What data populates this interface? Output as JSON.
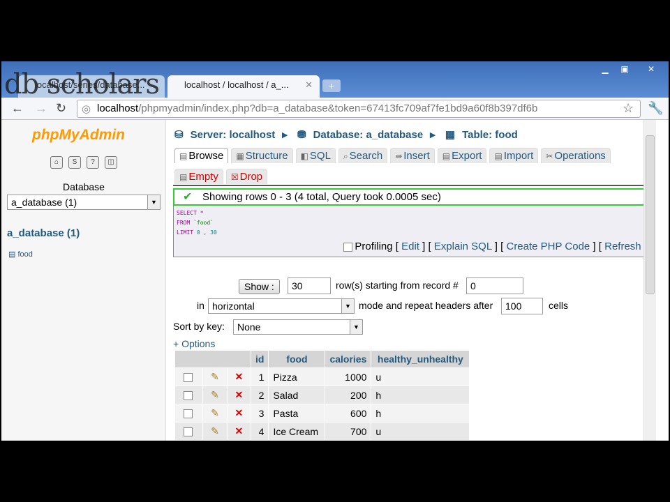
{
  "browser": {
    "tabs": [
      {
        "title": "localhost/series/database..."
      },
      {
        "title": "localhost / localhost / a_..."
      }
    ],
    "url_host": "localhost",
    "url_path": "/phpmyadmin/index.php?db=a_database&token=67413fc709af7fe1bd9a60f8b397df6b",
    "watermark": "db scholars"
  },
  "sidebar": {
    "logo_php": "php",
    "logo_myadmin": "MyAdmin",
    "database_label": "Database",
    "database_selected": "a_database (1)",
    "db_link": "a_database (1)",
    "tables": [
      "food"
    ]
  },
  "breadcrumb": {
    "server": "Server: localhost",
    "database": "Database: a_database",
    "table": "Table: food"
  },
  "tabs": [
    "Browse",
    "Structure",
    "SQL",
    "Search",
    "Insert",
    "Export",
    "Import",
    "Operations"
  ],
  "tabs2": [
    "Empty",
    "Drop"
  ],
  "message": "Showing rows 0 - 3 (4 total, Query took 0.0005 sec)",
  "sql": {
    "line1_kw": "SELECT",
    "line1_rest": " *",
    "line2_kw": "FROM",
    "line2_rest": " `food`",
    "line3_kw": "LIMIT",
    "line3_rest": " 0 , 30"
  },
  "sql_links": {
    "profiling": "Profiling",
    "edit": "Edit",
    "explain": "Explain SQL",
    "php": "Create PHP Code",
    "refresh": "Refresh"
  },
  "nav_form": {
    "show_button": "Show :",
    "rows_value": "30",
    "rows_label": "row(s) starting from record #",
    "start_value": "0",
    "in_label": "in",
    "mode_value": "horizontal",
    "mode_label": "mode and repeat headers after",
    "repeat_value": "100",
    "cells_label": "cells",
    "sort_label": "Sort by key:",
    "sort_value": "None",
    "options_link": "+ Options"
  },
  "table": {
    "columns": [
      "id",
      "food",
      "calories",
      "healthy_unhealthy"
    ],
    "rows": [
      [
        "1",
        "Pizza",
        "1000",
        "u"
      ],
      [
        "2",
        "Salad",
        "200",
        "h"
      ],
      [
        "3",
        "Pasta",
        "600",
        "h"
      ],
      [
        "4",
        "Ice Cream",
        "700",
        "u"
      ]
    ]
  }
}
